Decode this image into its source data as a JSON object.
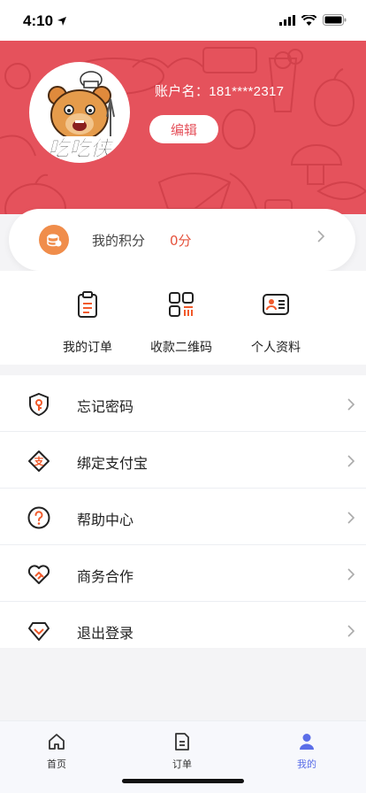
{
  "status_bar": {
    "time": "4:10"
  },
  "profile": {
    "account_label": "账户名：181****2317",
    "edit_label": "编辑",
    "logo_text": "吃吃侠"
  },
  "points": {
    "label": "我的积分",
    "value": "0分"
  },
  "quick_actions": [
    {
      "label": "我的订单",
      "icon": "clipboard-icon"
    },
    {
      "label": "收款二维码",
      "icon": "qr-code-icon"
    },
    {
      "label": "个人资料",
      "icon": "id-card-icon"
    }
  ],
  "menu": [
    {
      "label": "忘记密码",
      "icon": "shield-key-icon"
    },
    {
      "label": "绑定支付宝",
      "icon": "alipay-icon"
    },
    {
      "label": "帮助中心",
      "icon": "help-icon"
    },
    {
      "label": "商务合作",
      "icon": "handshake-heart-icon"
    },
    {
      "label": "退出登录",
      "icon": "logout-icon"
    }
  ],
  "tabs": [
    {
      "label": "首页",
      "icon": "home-icon"
    },
    {
      "label": "订单",
      "icon": "order-icon"
    },
    {
      "label": "我的",
      "icon": "profile-icon",
      "active": true
    }
  ],
  "colors": {
    "header": "#e5525c",
    "accent": "#f15a2b",
    "active_tab": "#5b6ee8",
    "points_value": "#e5523c"
  }
}
